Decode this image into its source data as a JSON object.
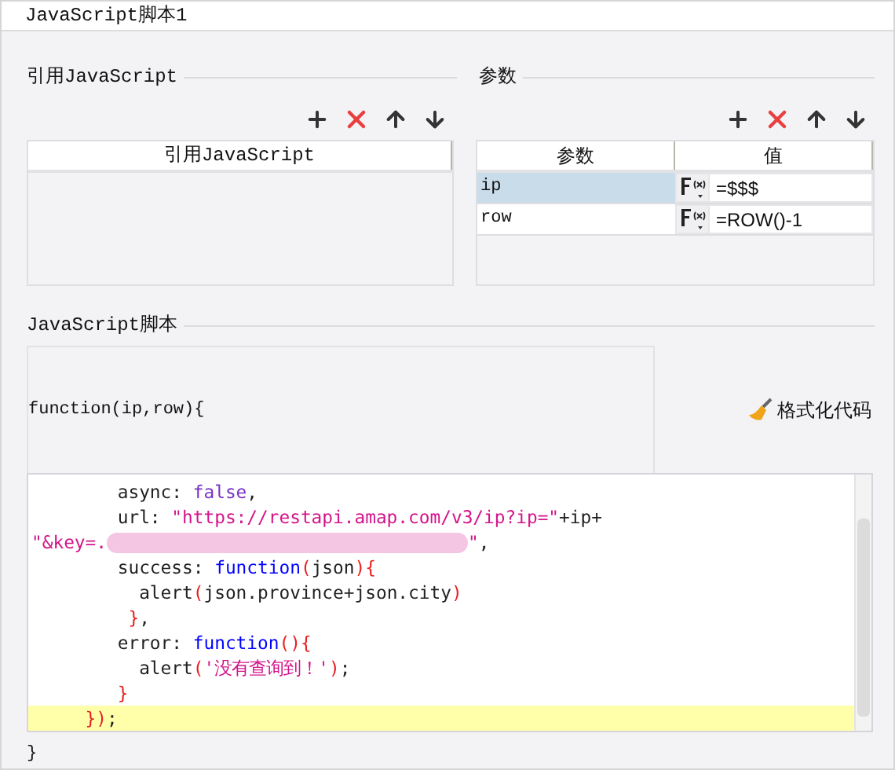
{
  "window": {
    "title": "JavaScript脚本1"
  },
  "references": {
    "title": "引用JavaScript",
    "toolbar": [
      {
        "kind": "add"
      },
      {
        "kind": "delete"
      },
      {
        "kind": "up"
      },
      {
        "kind": "down"
      }
    ],
    "columns": [
      "引用JavaScript"
    ]
  },
  "parameters": {
    "title": "参数",
    "toolbar": [
      {
        "kind": "add"
      },
      {
        "kind": "delete"
      },
      {
        "kind": "up"
      },
      {
        "kind": "down"
      }
    ],
    "columns": [
      "参数",
      "值"
    ],
    "rows": [
      {
        "name": "ip",
        "value": "=$$$",
        "selected": true
      },
      {
        "name": "row",
        "value": "=ROW()-1",
        "selected": false
      }
    ]
  },
  "script": {
    "title": "JavaScript脚本",
    "header": "function(ip,row){",
    "format_button": "格式化代码",
    "footer": "}",
    "lines": [
      {
        "highlighted": false,
        "tokens": [
          {
            "kind": "plain",
            "text": "        async: "
          },
          {
            "kind": "atom",
            "text": "false"
          },
          {
            "kind": "plain",
            "text": ","
          }
        ]
      },
      {
        "highlighted": false,
        "tokens": [
          {
            "kind": "plain",
            "text": "        url: "
          },
          {
            "kind": "string",
            "text": "\"https://restapi.amap.com/v3/ip?ip=\""
          },
          {
            "kind": "plain",
            "text": "+ip+"
          }
        ]
      },
      {
        "highlighted": false,
        "tokens": [
          {
            "kind": "string",
            "text": "\"&key=."
          },
          {
            "kind": "redacted"
          },
          {
            "kind": "string",
            "text": "\""
          },
          {
            "kind": "plain",
            "text": ","
          }
        ]
      },
      {
        "highlighted": false,
        "tokens": [
          {
            "kind": "plain",
            "text": "        success: "
          },
          {
            "kind": "keyword",
            "text": "function"
          },
          {
            "kind": "bracket",
            "text": "("
          },
          {
            "kind": "plain",
            "text": "json"
          },
          {
            "kind": "bracket",
            "text": "){"
          }
        ]
      },
      {
        "highlighted": false,
        "tokens": [
          {
            "kind": "plain",
            "text": "          alert"
          },
          {
            "kind": "bracket",
            "text": "("
          },
          {
            "kind": "plain",
            "text": "json.province+json.city"
          },
          {
            "kind": "bracket",
            "text": ")"
          }
        ]
      },
      {
        "highlighted": false,
        "tokens": [
          {
            "kind": "bracket",
            "text": "         }"
          },
          {
            "kind": "plain",
            "text": ","
          }
        ]
      },
      {
        "highlighted": false,
        "tokens": [
          {
            "kind": "plain",
            "text": "        error: "
          },
          {
            "kind": "keyword",
            "text": "function"
          },
          {
            "kind": "bracket",
            "text": "(){"
          }
        ]
      },
      {
        "highlighted": false,
        "tokens": [
          {
            "kind": "plain",
            "text": "          alert"
          },
          {
            "kind": "bracket",
            "text": "("
          },
          {
            "kind": "string",
            "text": "'没有查询到！'"
          },
          {
            "kind": "bracket",
            "text": ")"
          },
          {
            "kind": "plain",
            "text": ";"
          }
        ]
      },
      {
        "highlighted": false,
        "tokens": [
          {
            "kind": "bracket",
            "text": "        }"
          }
        ]
      },
      {
        "highlighted": true,
        "tokens": [
          {
            "kind": "bracket",
            "text": "     })"
          },
          {
            "kind": "plain",
            "text": ";"
          }
        ]
      }
    ]
  }
}
